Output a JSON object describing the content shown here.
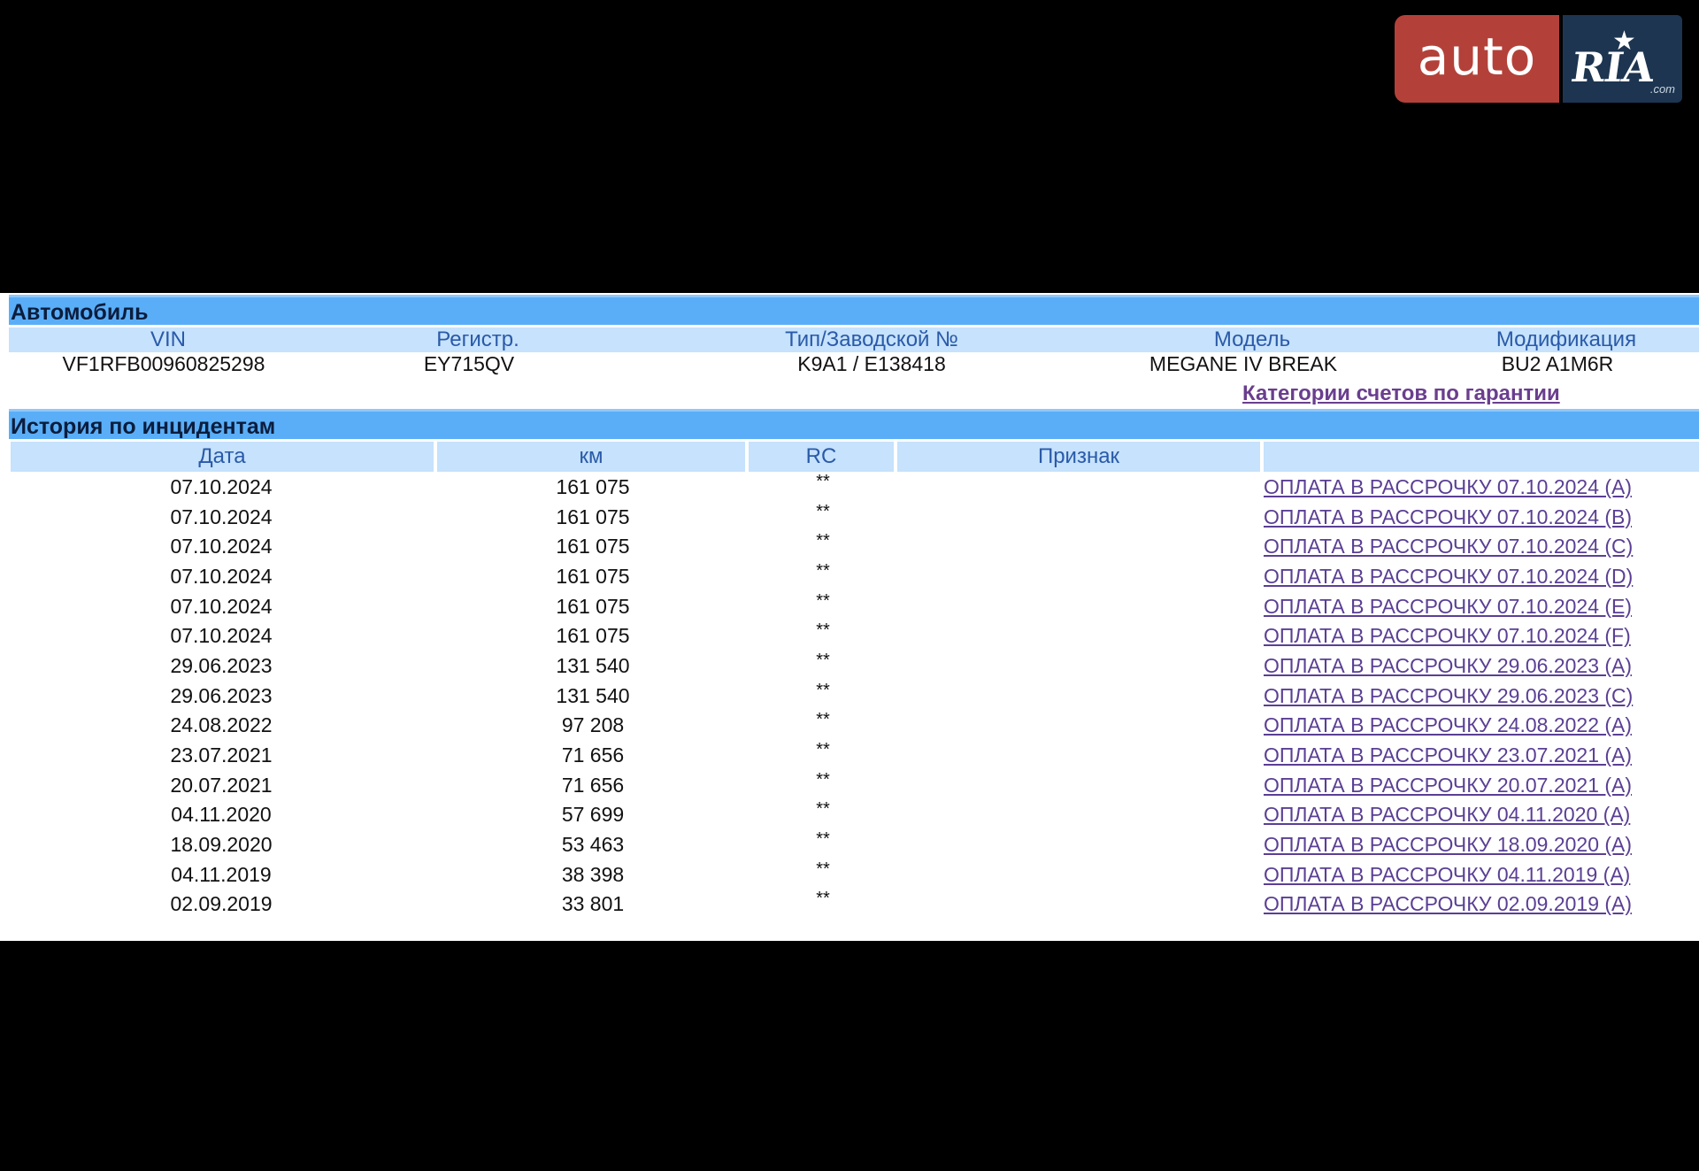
{
  "logo": {
    "auto": "auto",
    "ria": "RIA",
    "com": ".com"
  },
  "vehicle": {
    "section_title": "Автомобиль",
    "headers": [
      "VIN",
      "Регистр.",
      "Тип/Заводской №",
      "Модель",
      "Модификация"
    ],
    "values": [
      "VF1RFB00960825298",
      "EY715QV",
      "K9A1 / E138418",
      "MEGANE IV BREAK",
      "BU2 A1M6R"
    ],
    "warranty_link": "Категории счетов по гарантии"
  },
  "history": {
    "section_title": "История по инцидентам",
    "headers": [
      "Дата",
      "км",
      "RC",
      "Признак",
      ""
    ],
    "rows": [
      {
        "date": "07.10.2024",
        "km": "161 075",
        "rc": "**",
        "sign": "",
        "link": "ОПЛАТА В РАССРОЧКУ 07.10.2024 (A)"
      },
      {
        "date": "07.10.2024",
        "km": "161 075",
        "rc": "**",
        "sign": "",
        "link": "ОПЛАТА В РАССРОЧКУ 07.10.2024 (B)"
      },
      {
        "date": "07.10.2024",
        "km": "161 075",
        "rc": "**",
        "sign": "",
        "link": "ОПЛАТА В РАССРОЧКУ 07.10.2024 (C)"
      },
      {
        "date": "07.10.2024",
        "km": "161 075",
        "rc": "**",
        "sign": "",
        "link": "ОПЛАТА В РАССРОЧКУ 07.10.2024 (D)"
      },
      {
        "date": "07.10.2024",
        "km": "161 075",
        "rc": "**",
        "sign": "",
        "link": "ОПЛАТА В РАССРОЧКУ 07.10.2024 (E)"
      },
      {
        "date": "07.10.2024",
        "km": "161 075",
        "rc": "**",
        "sign": "",
        "link": "ОПЛАТА В РАССРОЧКУ 07.10.2024 (F)"
      },
      {
        "date": "29.06.2023",
        "km": "131 540",
        "rc": "**",
        "sign": "",
        "link": "ОПЛАТА В РАССРОЧКУ 29.06.2023 (A)"
      },
      {
        "date": "29.06.2023",
        "km": "131 540",
        "rc": "**",
        "sign": "",
        "link": "ОПЛАТА В РАССРОЧКУ 29.06.2023 (C)"
      },
      {
        "date": "24.08.2022",
        "km": "97 208",
        "rc": "**",
        "sign": "",
        "link": "ОПЛАТА В РАССРОЧКУ 24.08.2022 (A)"
      },
      {
        "date": "23.07.2021",
        "km": "71 656",
        "rc": "**",
        "sign": "",
        "link": "ОПЛАТА В РАССРОЧКУ 23.07.2021 (A)"
      },
      {
        "date": "20.07.2021",
        "km": "71 656",
        "rc": "**",
        "sign": "",
        "link": "ОПЛАТА В РАССРОЧКУ 20.07.2021 (A)"
      },
      {
        "date": "04.11.2020",
        "km": "57 699",
        "rc": "**",
        "sign": "",
        "link": "ОПЛАТА В РАССРОЧКУ 04.11.2020 (A)"
      },
      {
        "date": "18.09.2020",
        "km": "53 463",
        "rc": "**",
        "sign": "",
        "link": "ОПЛАТА В РАССРОЧКУ 18.09.2020 (A)"
      },
      {
        "date": "04.11.2019",
        "km": "38 398",
        "rc": "**",
        "sign": "",
        "link": "ОПЛАТА В РАССРОЧКУ 04.11.2019 (A)"
      },
      {
        "date": "02.09.2019",
        "km": "33 801",
        "rc": "**",
        "sign": "",
        "link": "ОПЛАТА В РАССРОЧКУ 02.09.2019 (A)"
      }
    ]
  },
  "colors": {
    "section_bar": "#5aaef7",
    "header_bar": "#c6e2fc",
    "header_text": "#2a5aa8",
    "link": "#5a3f94",
    "logo_red": "#b3413a",
    "logo_navy": "#1d3550"
  }
}
